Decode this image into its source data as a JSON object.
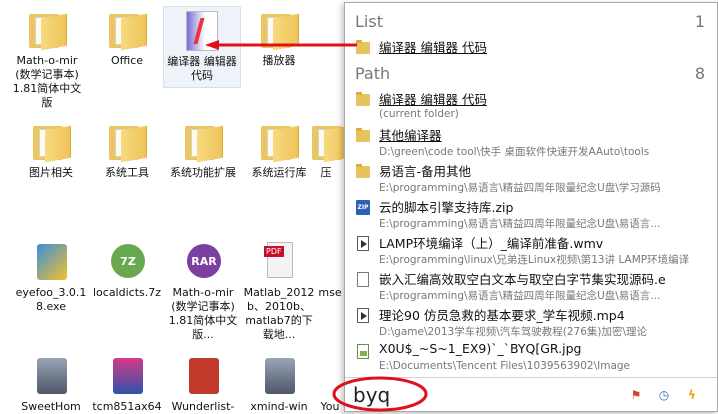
{
  "desktop": {
    "icons": [
      {
        "label": "Math-o-mir(数学记事本) 1.81简体中文版",
        "type": "folder"
      },
      {
        "label": "Office",
        "type": "folder"
      },
      {
        "label": "编译器 编辑器 代码",
        "type": "app",
        "selected": true
      },
      {
        "label": "播放器",
        "type": "folder"
      },
      {
        "label": "图片相关",
        "type": "folder"
      },
      {
        "label": "系统工具",
        "type": "folder"
      },
      {
        "label": "系统功能扩展",
        "type": "folder"
      },
      {
        "label": "系统运行库",
        "type": "folder"
      },
      {
        "label": "压",
        "type": "folder"
      },
      {
        "label": "eyefoo_3.0.18.exe",
        "type": "exe"
      },
      {
        "label": "localdicts.7z",
        "type": "7z"
      },
      {
        "label": "Math-o-mir(数学记事本) 1.81简体中文版...",
        "type": "rar"
      },
      {
        "label": "Matlab_2012b、2010b、matlab7的下载地...",
        "type": "pdf"
      },
      {
        "label": "mse",
        "type": "exe"
      },
      {
        "label": "SweetHom",
        "type": "installer"
      },
      {
        "label": "tcm851ax64",
        "type": "installer"
      },
      {
        "label": "Wunderlist-",
        "type": "installer"
      },
      {
        "label": "xmind-win",
        "type": "installer"
      },
      {
        "label": "You",
        "type": "installer"
      }
    ]
  },
  "popup": {
    "list_section": {
      "title": "List",
      "count": "1"
    },
    "list_items": [
      {
        "name": "编译器 编辑器 代码",
        "icon": "folder-icon"
      }
    ],
    "path_section": {
      "title": "Path",
      "count": "8"
    },
    "path_items": [
      {
        "name": "编译器 编辑器 代码",
        "path": "(current folder)",
        "icon": "folder-icon"
      },
      {
        "name": "其他编译器",
        "path": "D:\\green\\code tool\\快手 桌面软件快速开发AAuto\\tools",
        "icon": "folder-icon"
      },
      {
        "name": "易语言-备用其他",
        "path": "E:\\programming\\易语言\\精益四周年限量纪念U盘\\学习源码",
        "icon": "folder-icon"
      },
      {
        "name": "云的脚本引擎支持库.zip",
        "path": "E:\\programming\\易语言\\精益四周年限量纪念U盘\\易语言...",
        "icon": "zip-icon"
      },
      {
        "name": "LAMP环境编译（上）_编译前准备.wmv",
        "path": "E:\\programming\\linux\\兄弟连Linux视频\\第13讲 LAMP环境编译",
        "icon": "video-icon"
      },
      {
        "name": "嵌入汇编高效取空白文本与取空白字节集实现源码.e",
        "path": "E:\\programming\\易语言\\精益四周年限量纪念U盘\\易语言...",
        "icon": "document-icon"
      },
      {
        "name": "理论90 仿员急救的基本要求_学车视频.mp4",
        "path": "D:\\game\\2013学车视频\\汽车驾驶教程(276集)加密\\理论",
        "icon": "video-icon"
      },
      {
        "name": "X0U$_~S~1_EX9)`_`BYQ[GR.jpg",
        "path": "E:\\Documents\\Tencent Files\\1039563902\\Image",
        "icon": "image-icon"
      }
    ],
    "search": {
      "value": "byq",
      "placeholder": ""
    },
    "toolbar": [
      {
        "name": "flag-icon",
        "glyph": "⚑"
      },
      {
        "name": "clock-icon",
        "glyph": "◷"
      },
      {
        "name": "bolt-icon",
        "glyph": "ϟ"
      }
    ]
  },
  "colors": {
    "annotation": "#e0101c",
    "folder": "#e8c35b"
  }
}
